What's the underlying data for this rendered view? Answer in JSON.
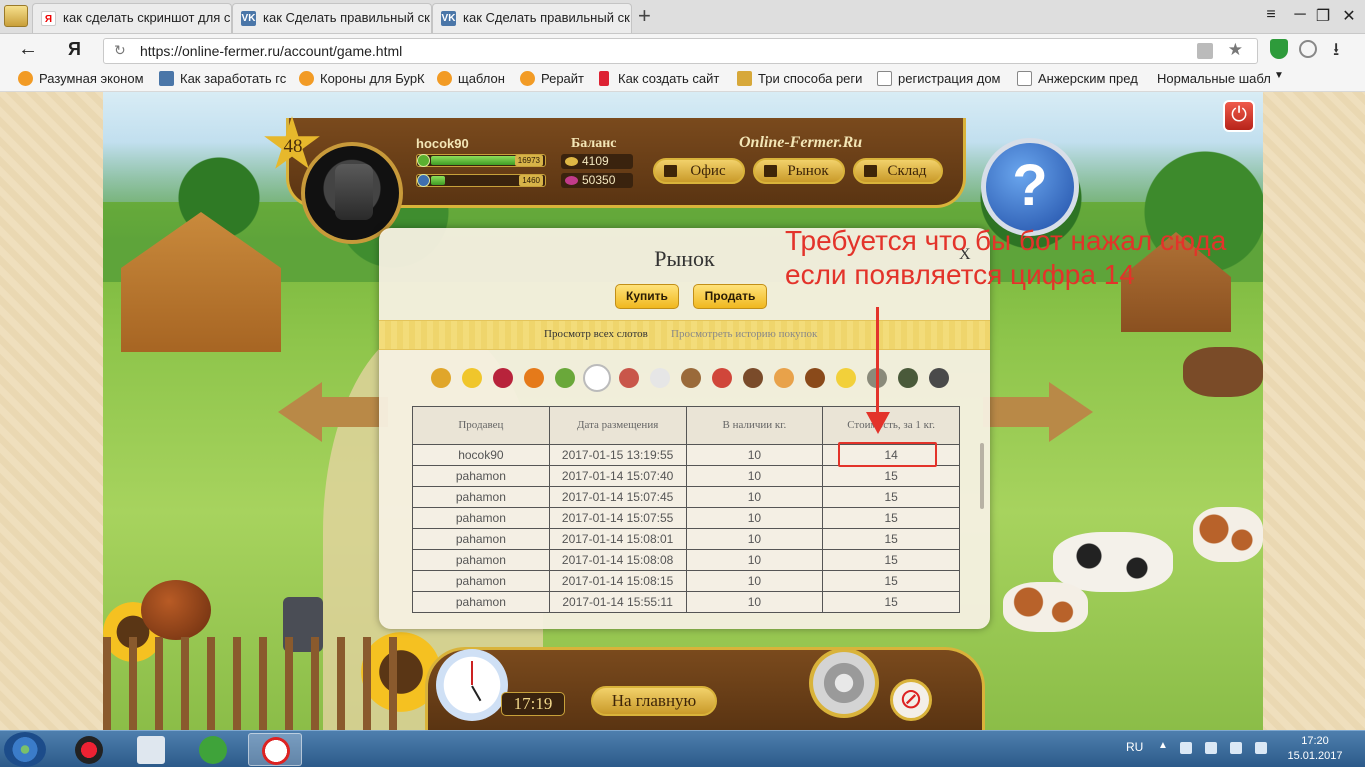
{
  "browser": {
    "tabs": [
      {
        "label": "как сделать скриншот для с",
        "favicon": "Я"
      },
      {
        "label": "как Сделать правильный ск",
        "favicon": "VK"
      },
      {
        "label": "как Сделать правильный ск",
        "favicon": "VK"
      }
    ],
    "new_tab": "+",
    "window_controls": {
      "menu": "≡",
      "minimize": "─",
      "restore": "❐",
      "close": "✕"
    },
    "back": "←",
    "yandex_logo": "Я",
    "reload": "↻",
    "url": "https://online-fermer.ru/account/game.html",
    "bookmark_star": "★",
    "protect_badge": "4",
    "download": "⭳",
    "bookmarks": [
      {
        "label": "Разумная эконом",
        "icon": "orange"
      },
      {
        "label": "Как заработать гс",
        "icon": "vk"
      },
      {
        "label": "Короны для БурК",
        "icon": "orange"
      },
      {
        "label": "щаблон",
        "icon": "orange"
      },
      {
        "label": "Рерайт",
        "icon": "orange"
      },
      {
        "label": "Как создать сайт",
        "icon": "red"
      },
      {
        "label": "Три способа реги",
        "icon": "img"
      },
      {
        "label": "регистрация дом",
        "icon": "doc"
      },
      {
        "label": "Анжерским пред",
        "icon": "doc"
      },
      {
        "label": "Нормальные шабл",
        "icon": "none"
      }
    ],
    "bookmarks_more": "▼"
  },
  "game": {
    "level": "48",
    "username": "hocok90",
    "xp_value": "16973",
    "xp_fraction": 0.85,
    "energy_value": "1460",
    "energy_fraction": 0.12,
    "balance_title": "Баланс",
    "coins": "4109",
    "crystals": "50350",
    "brand": "Online-Fermer.Ru",
    "nav": {
      "office": "Офис",
      "market": "Рынок",
      "storage": "Склад"
    },
    "help_symbol": "?",
    "power_symbol": "⏻",
    "time": "17:19",
    "home_button": "На главную",
    "mute_symbol": "⊘"
  },
  "market": {
    "title": "Рынок",
    "close": "X",
    "buy_label": "Купить",
    "sell_label": "Продать",
    "view_all_slots": "Просмотр всех слотов",
    "view_history": "Просмотреть историю покупок",
    "product_icons": [
      "wheat-icon",
      "corn-icon",
      "beet-icon",
      "pumpkin-icon",
      "peas-icon",
      "egg-icon",
      "meat-icon",
      "milk-icon",
      "butter-icon",
      "sausage-icon",
      "jug-icon",
      "cheese-slice-icon",
      "bread-icon",
      "cheese-icon",
      "bag-icon",
      "dough-icon",
      "bucket-icon"
    ],
    "selected_icon": 5,
    "columns": [
      "Продавец",
      "Дата размещения",
      "В наличии кг.",
      "Стоимость, за 1 кг."
    ],
    "rows": [
      {
        "seller": "hocok90",
        "date": "2017-01-15 13:19:55",
        "qty": "10",
        "price": "14"
      },
      {
        "seller": "pahamon",
        "date": "2017-01-14 15:07:40",
        "qty": "10",
        "price": "15"
      },
      {
        "seller": "pahamon",
        "date": "2017-01-14 15:07:45",
        "qty": "10",
        "price": "15"
      },
      {
        "seller": "pahamon",
        "date": "2017-01-14 15:07:55",
        "qty": "10",
        "price": "15"
      },
      {
        "seller": "pahamon",
        "date": "2017-01-14 15:08:01",
        "qty": "10",
        "price": "15"
      },
      {
        "seller": "pahamon",
        "date": "2017-01-14 15:08:08",
        "qty": "10",
        "price": "15"
      },
      {
        "seller": "pahamon",
        "date": "2017-01-14 15:08:15",
        "qty": "10",
        "price": "15"
      },
      {
        "seller": "pahamon",
        "date": "2017-01-14 15:55:11",
        "qty": "10",
        "price": "15"
      }
    ]
  },
  "annotation": {
    "line1": "Требуется что бы бот нажал сюда",
    "line2": "если появляется цифра 14",
    "color": "#e3332a"
  },
  "taskbar": {
    "lang": "RU",
    "tray_arrow": "▲",
    "time": "17:20",
    "date": "15.01.2017"
  }
}
